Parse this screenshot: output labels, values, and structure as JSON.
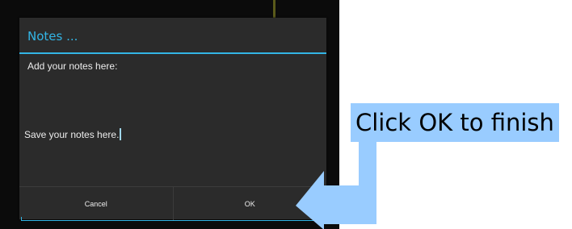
{
  "dialog": {
    "title": "Notes ...",
    "notes_prompt": "Add your notes here:",
    "notes_text": "Save your notes here.",
    "cancel_label": "Cancel",
    "ok_label": "OK"
  },
  "annotation": {
    "text": "Click OK to finish"
  },
  "colors": {
    "accent": "#33b5e5",
    "dialog_bg": "#2b2b2b",
    "annotation_bg": "#99ccff"
  },
  "icons": [
    "arrow-icon"
  ]
}
